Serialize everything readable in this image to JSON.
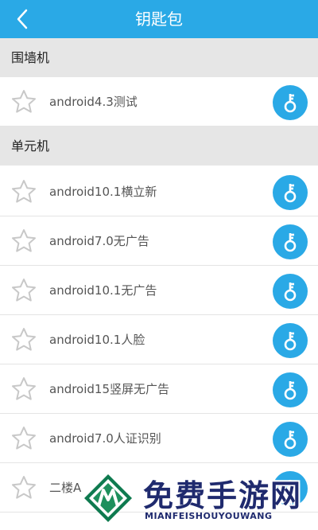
{
  "header": {
    "title": "钥匙包"
  },
  "sections": [
    {
      "title": "围墙机",
      "items": [
        "android4.3测试"
      ]
    },
    {
      "title": "单元机",
      "items": [
        "android10.1横立新",
        "android7.0无广告",
        "android10.1无广告",
        "android10.1人脸",
        "android15竖屏无广告",
        "android7.0人证识别",
        "二楼A"
      ]
    }
  ],
  "watermark": {
    "title": "免费手游网",
    "subtitle": "MIANFEISHOUYOUWANG"
  },
  "colors": {
    "accent": "#2aa9e6",
    "section_bg": "#e6e6e6",
    "star": "#c8c8c8"
  },
  "icons": {
    "back": "chevron-left-icon",
    "favorite": "star-outline-icon",
    "key": "key-icon"
  }
}
